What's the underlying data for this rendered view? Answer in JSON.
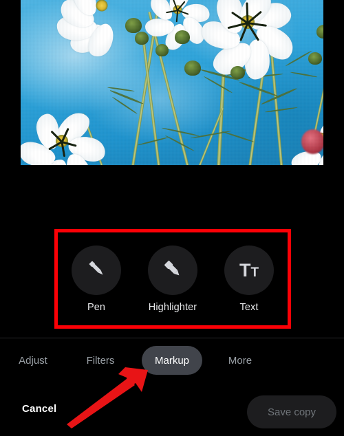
{
  "app": {
    "screen_name": "Photo editor — Markup",
    "background": "#000000"
  },
  "preview": {
    "photo_alt": "White cosmos flowers against a blue sky",
    "sky_color": "#2ea3da",
    "petal_color": "#ffffff",
    "stem_color": "#8fa84f"
  },
  "markup": {
    "highlight_box_color": "#fb0006",
    "tools": [
      {
        "id": "pen",
        "label": "Pen",
        "icon": "pen-icon"
      },
      {
        "id": "highlighter",
        "label": "Highlighter",
        "icon": "highlighter-icon"
      },
      {
        "id": "text",
        "label": "Text",
        "icon": "text-size-icon",
        "glyph_big": "T",
        "glyph_small": "T"
      }
    ]
  },
  "tabs": {
    "items": [
      {
        "id": "adjust",
        "label": "Adjust",
        "active": false
      },
      {
        "id": "filters",
        "label": "Filters",
        "active": false
      },
      {
        "id": "markup",
        "label": "Markup",
        "active": true
      },
      {
        "id": "more",
        "label": "More",
        "active": false
      }
    ],
    "active_pill_color": "#41444b",
    "inactive_label_color": "#9aa0a6"
  },
  "footer": {
    "cancel_label": "Cancel",
    "save_label": "Save copy",
    "save_enabled": false,
    "save_label_color": "#70757a"
  },
  "annotation": {
    "arrow_color": "#e81416",
    "arrow_points_to": "Markup"
  }
}
